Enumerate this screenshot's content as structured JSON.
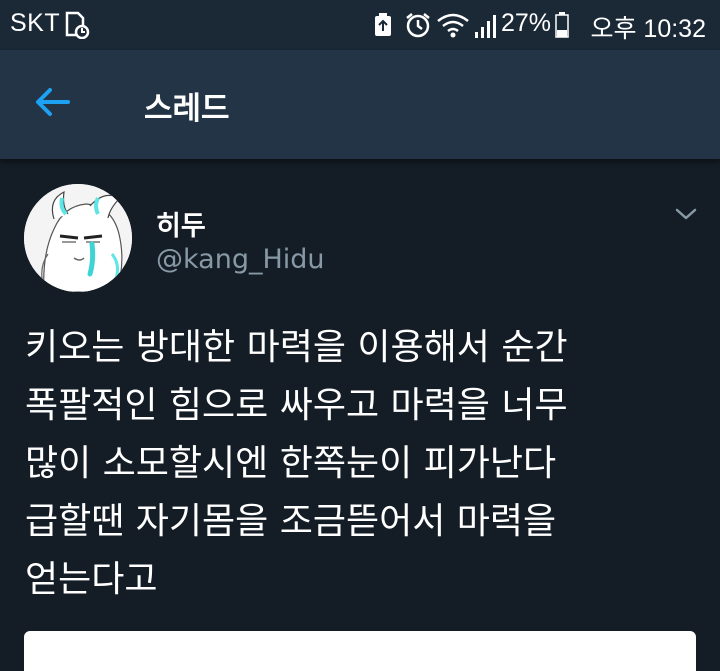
{
  "status_bar": {
    "carrier": "SKT",
    "battery_percent": "27%",
    "time": "오후 10:32",
    "icons": [
      "sim-card-icon",
      "battery-saver-icon",
      "alarm-clock-icon",
      "wifi-icon",
      "signal-icon",
      "battery-icon"
    ]
  },
  "header": {
    "title": "스레드",
    "back_icon": "arrow-left-icon",
    "accent_color": "#1da1f2"
  },
  "tweet": {
    "display_name": "히두",
    "handle": "@kang_Hidu",
    "text": "키오는 방대한 마력을 이용해서 순간\n폭팔적인 힘으로 싸우고 마력을 너무\n많이 소모할시엔 한쪽눈이 피가난다\n급할땐 자기몸을 조금뜯어서 마력을\n얻는다고",
    "menu_icon": "chevron-down-icon"
  },
  "colors": {
    "background": "#141d26",
    "header_background": "#243447",
    "status_bar_background": "#1b2836",
    "secondary_text": "#8899a6"
  }
}
